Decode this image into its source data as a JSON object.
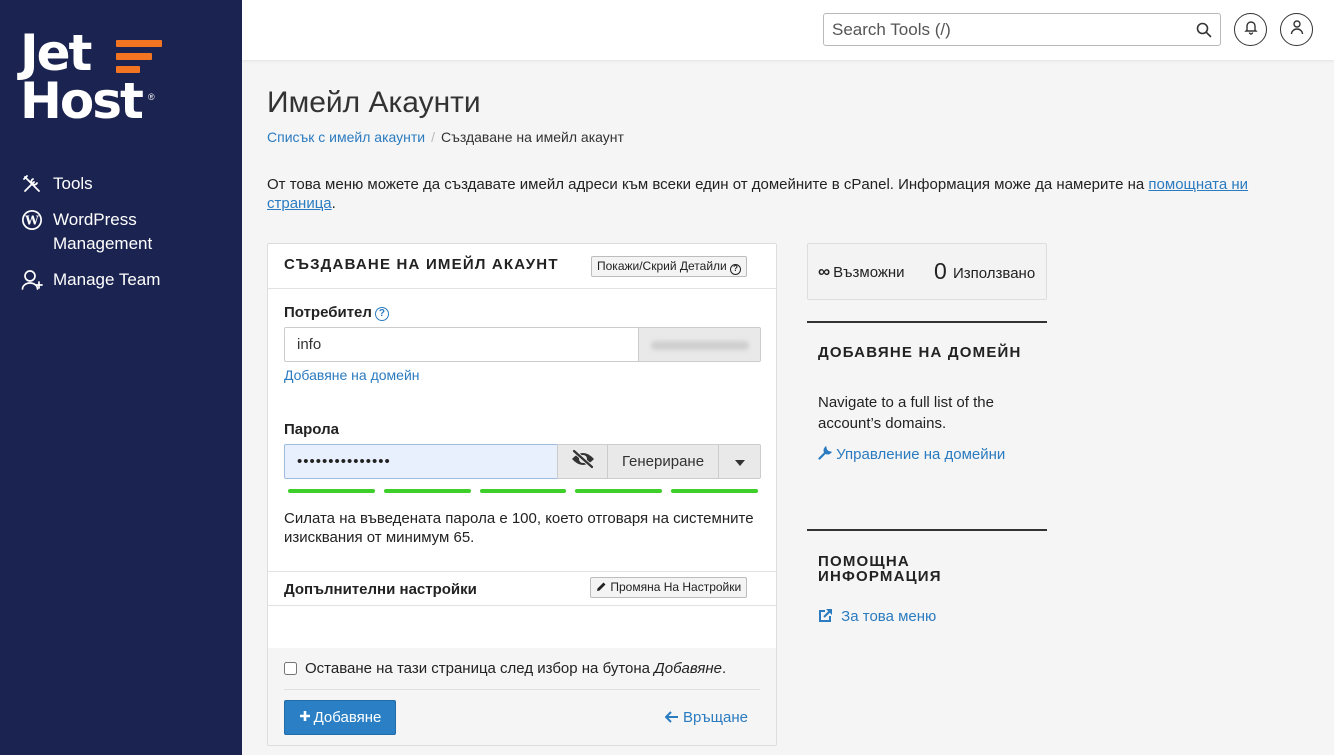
{
  "brand": {
    "logo_line1": "Jet",
    "logo_line2": "Host",
    "logo_accent_color": "#f47521",
    "sidebar_color": "#1b2450"
  },
  "sidebar": {
    "items": [
      {
        "label": "Tools",
        "icon": "tools-icon"
      },
      {
        "label": "WordPress\nManagement",
        "icon": "wordpress-icon"
      },
      {
        "label": "Manage Team",
        "icon": "manage-team-icon"
      }
    ]
  },
  "header": {
    "search_placeholder": "Search Tools (/)"
  },
  "page": {
    "title": "Имейл Акаунти",
    "breadcrumb_link": "Списък с имейл акаунти",
    "breadcrumb_separator": "/",
    "breadcrumb_current": "Създаване на имейл акаунт",
    "intro_text": "От това меню можете да създавате имейл адреси към всеки един от домейните в cPanel. Информация може да намерите на ",
    "intro_link": "помощната ни страница",
    "intro_end": "."
  },
  "form": {
    "title": "СЪЗДАВАНЕ НА ИМЕЙЛ АКАУНТ",
    "toggle_details": "Покажи/Скрий Детайли",
    "user_label": "Потребител",
    "user_value": "info",
    "add_domain_link": "Добавяне на домейн",
    "password_label": "Парола",
    "password_value": "•••••••••••••••",
    "generate_label": "Генериране",
    "strength_score": 100,
    "strength_text": "Силата на въведената парола е 100, което отговаря на системните изисквания от минимум 65.",
    "extra_title": "Допълнителни настройки",
    "change_settings": "Промяна На Настройки",
    "stay_text": "Оставане на тази страница след избор на бутона ",
    "stay_em": "Добавяне",
    "stay_end": ".",
    "add_button": "Добавяне",
    "back_link": "Връщане"
  },
  "side": {
    "possible_label": "Възможни",
    "used_count": "0",
    "used_label": "Използвано",
    "add_domain_title": "ДОБАВЯНЕ НА ДОМЕЙН",
    "add_domain_text": "Navigate to a full list of the account’s domains.",
    "manage_domains_link": "Управление на домейни",
    "help_title_1": "ПОМОЩНА",
    "help_title_2": "ИНФОРМАЦИЯ",
    "about_menu_link": "За това меню"
  }
}
